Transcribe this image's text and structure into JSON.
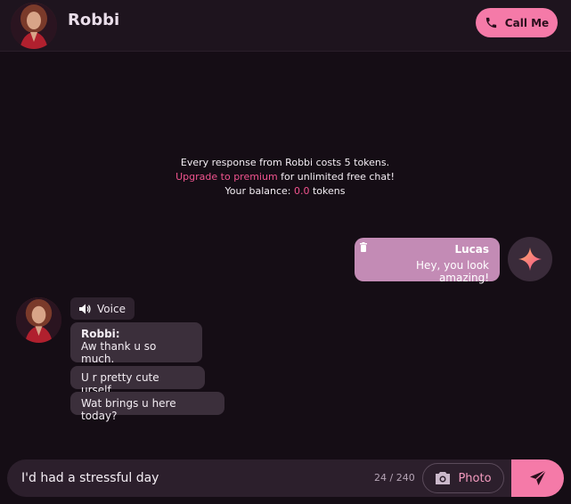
{
  "header": {
    "title": "Robbi",
    "call_label": "Call Me"
  },
  "notice": {
    "line1": "Every response from Robbi costs 5 tokens.",
    "upgrade_link": "Upgrade to premium",
    "line2_rest": " for unlimited free chat!",
    "balance_prefix": "Your balance: ",
    "balance_value": "0.0",
    "balance_suffix": " tokens"
  },
  "user_message": {
    "sender": "Lucas",
    "text": "Hey, you look amazing!"
  },
  "bot": {
    "voice_label": "Voice",
    "sender": "Robbi:",
    "messages": [
      "Aw thank u so much.",
      "U r pretty cute urself.",
      "Wat brings u here today?"
    ]
  },
  "composer": {
    "input_value": "I'd had a stressful day",
    "counter": "24 / 240",
    "photo_label": "Photo"
  },
  "colors": {
    "accent": "#f57aa8",
    "link_pink": "#f1548f",
    "background": "#150d15",
    "user_bubble": "#c38bb5",
    "bot_bubble": "#3b2f3b"
  },
  "icons": {
    "call": "phone-icon",
    "trash": "trash-icon",
    "sparkle": "sparkle-icon",
    "voice": "speaker-icon",
    "camera": "camera-icon",
    "send": "send-icon"
  }
}
